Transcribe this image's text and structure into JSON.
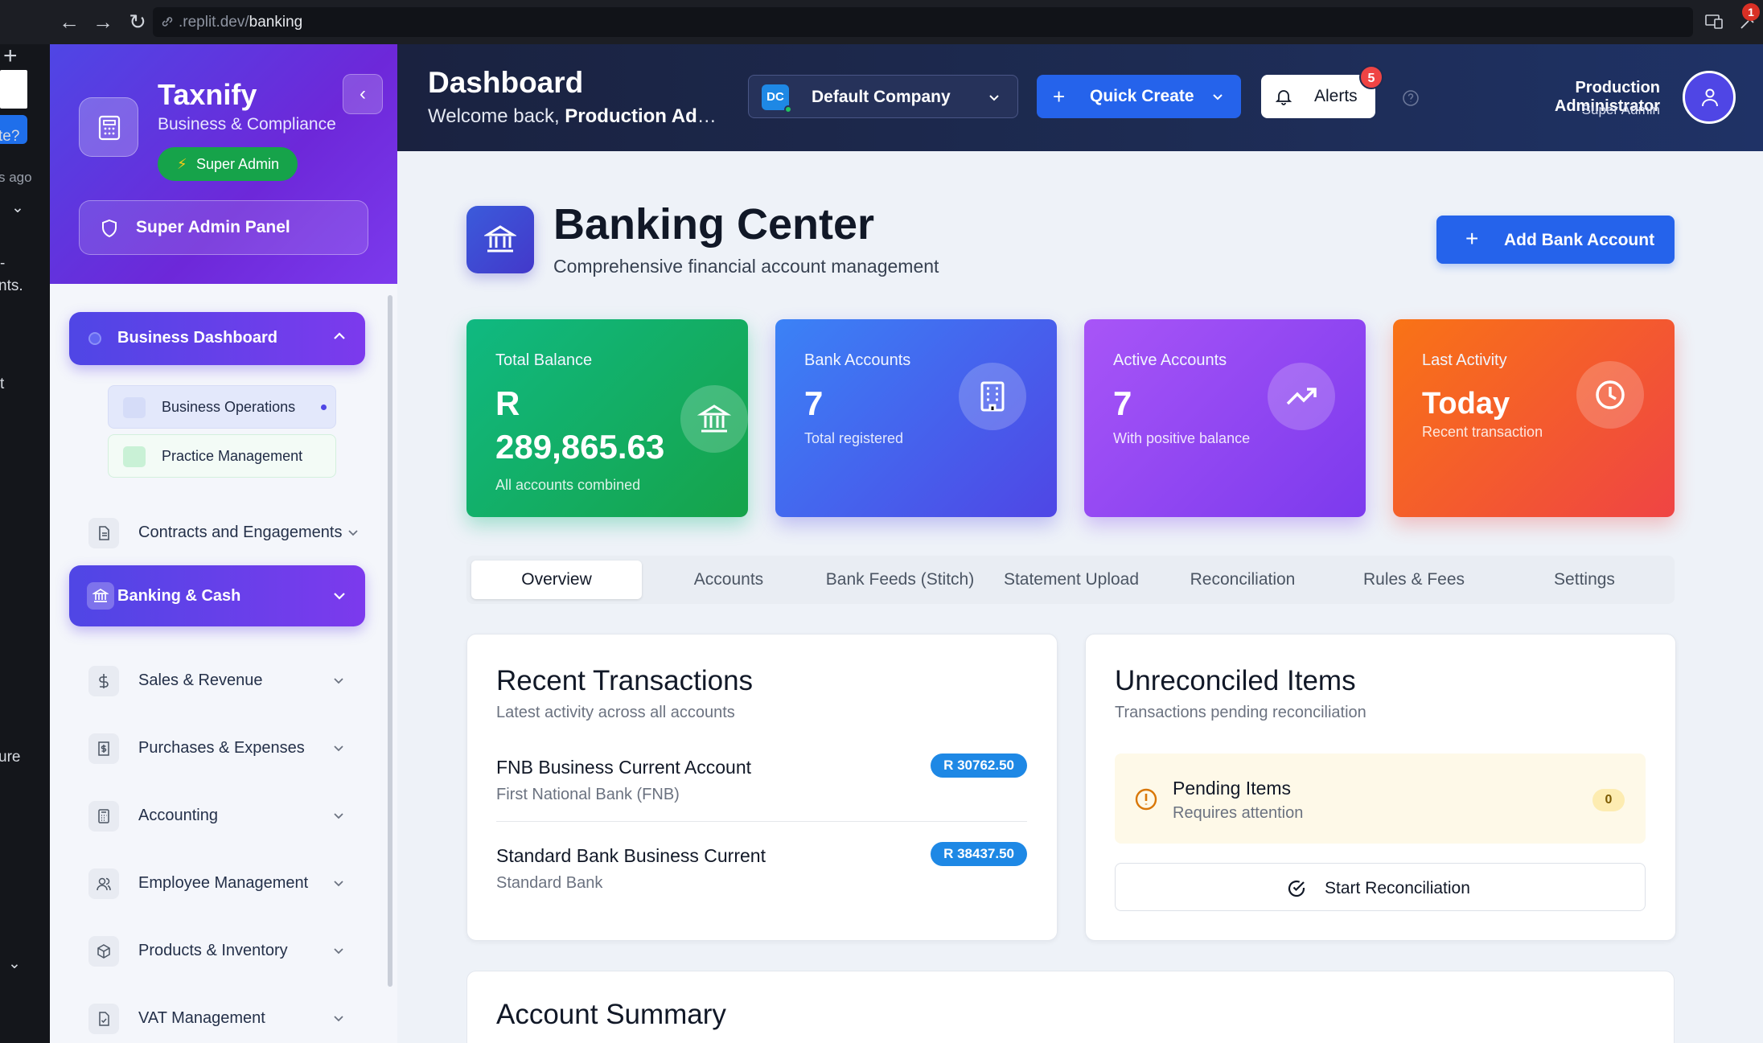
{
  "browser": {
    "url_prefix": ".replit.dev/",
    "url_path": "banking",
    "notification_count": "1"
  },
  "left_strip": {
    "texts": [
      "te?",
      "s ago",
      "-",
      "nts.",
      "t",
      "ure"
    ]
  },
  "sidebar": {
    "brand": "Taxnify",
    "brand_sub": "Business & Compliance",
    "role_pill": "Super Admin",
    "panel_button": "Super Admin Panel",
    "business_dashboard": "Business Dashboard",
    "sub_items": [
      "Business Operations",
      "Practice Management"
    ],
    "contracts": "Contracts and Engagements",
    "banking": "Banking & Cash",
    "items": [
      {
        "label": "Sales & Revenue",
        "icon": "dollar-icon"
      },
      {
        "label": "Purchases & Expenses",
        "icon": "receipt-icon"
      },
      {
        "label": "Accounting",
        "icon": "calculator-icon"
      },
      {
        "label": "Employee Management",
        "icon": "users-icon"
      },
      {
        "label": "Products & Inventory",
        "icon": "package-icon"
      },
      {
        "label": "VAT Management",
        "icon": "file-check-icon"
      }
    ]
  },
  "header": {
    "title": "Dashboard",
    "welcome_prefix": "Welcome back, ",
    "welcome_name": "Production Administrator",
    "company_initials": "DC",
    "company": "Default Company",
    "quick_create": "Quick Create",
    "alerts": "Alerts",
    "alerts_count": "5",
    "user_name": "Production Administrator",
    "user_role": "Super Admin"
  },
  "page": {
    "title": "Banking Center",
    "subtitle": "Comprehensive financial account management",
    "add_button": "Add Bank Account"
  },
  "stats": [
    {
      "label": "Total Balance",
      "value": "R 289,865.63",
      "caption": "All accounts combined",
      "color": "#10b981"
    },
    {
      "label": "Bank Accounts",
      "value": "7",
      "caption": "Total registered",
      "color": "#3b82f6"
    },
    {
      "label": "Active Accounts",
      "value": "7",
      "caption": "With positive balance",
      "color": "#a855f7"
    },
    {
      "label": "Last Activity",
      "value": "Today",
      "caption": "Recent transaction",
      "color": "#f97316"
    }
  ],
  "tabs": [
    "Overview",
    "Accounts",
    "Bank Feeds (Stitch)",
    "Statement Upload",
    "Reconciliation",
    "Rules & Fees",
    "Settings"
  ],
  "recent": {
    "title": "Recent Transactions",
    "subtitle": "Latest activity across all accounts",
    "items": [
      {
        "name": "FNB Business Current Account",
        "bank": "First National Bank (FNB)",
        "amount": "R 30762.50"
      },
      {
        "name": "Standard Bank Business Current",
        "bank": "Standard Bank",
        "amount": "R 38437.50"
      }
    ]
  },
  "unreconciled": {
    "title": "Unreconciled Items",
    "subtitle": "Transactions pending reconciliation",
    "pending_title": "Pending Items",
    "pending_sub": "Requires attention",
    "pending_count": "0",
    "button": "Start Reconciliation"
  },
  "summary": {
    "title": "Account Summary"
  }
}
